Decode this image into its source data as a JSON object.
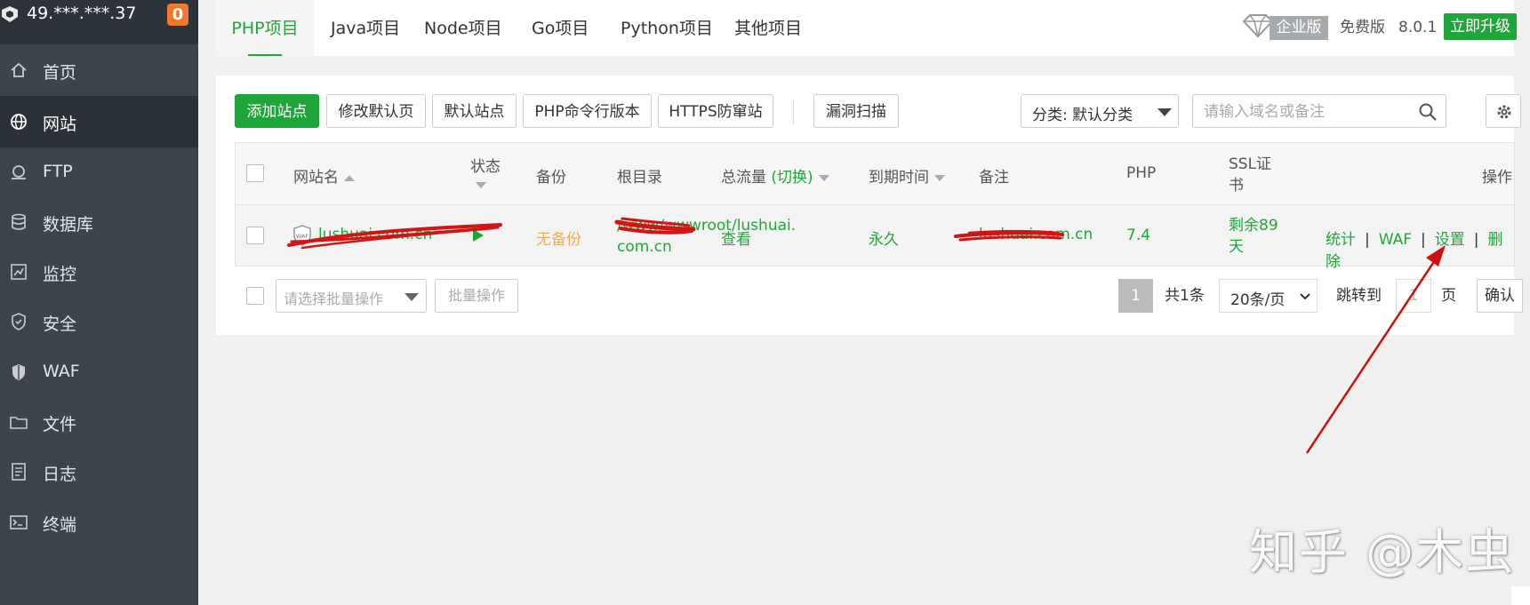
{
  "sidebar": {
    "server_ip": "49.***.***.37",
    "notification_count": "0",
    "items": [
      {
        "label": "首页",
        "icon": "home-icon",
        "active": false
      },
      {
        "label": "网站",
        "icon": "globe-icon",
        "active": true
      },
      {
        "label": "FTP",
        "icon": "ftp-icon",
        "active": false
      },
      {
        "label": "数据库",
        "icon": "database-icon",
        "active": false
      },
      {
        "label": "监控",
        "icon": "monitor-icon",
        "active": false
      },
      {
        "label": "安全",
        "icon": "shield-icon",
        "active": false
      },
      {
        "label": "WAF",
        "icon": "waf-shield-icon",
        "active": false
      },
      {
        "label": "文件",
        "icon": "folder-icon",
        "active": false
      },
      {
        "label": "日志",
        "icon": "log-icon",
        "active": false
      },
      {
        "label": "终端",
        "icon": "terminal-icon",
        "active": false
      }
    ]
  },
  "tabs": [
    {
      "label": "PHP项目",
      "active": true
    },
    {
      "label": "Java项目",
      "active": false
    },
    {
      "label": "Node项目",
      "active": false
    },
    {
      "label": "Go项目",
      "active": false
    },
    {
      "label": "Python项目",
      "active": false
    },
    {
      "label": "其他项目",
      "active": false
    }
  ],
  "header": {
    "enterprise_label": "企业版",
    "edition_label": "免费版",
    "version": "8.0.1",
    "upgrade_label": "立即升级"
  },
  "toolbar": {
    "add_site": "添加站点",
    "modify_default_page": "修改默认页",
    "default_site": "默认站点",
    "php_cli_version": "PHP命令行版本",
    "https_anti_snoop": "HTTPS防窜站",
    "vuln_scan": "漏洞扫描",
    "category_select": "分类: 默认分类",
    "search_placeholder": "请输入域名或备注"
  },
  "table": {
    "headers": {
      "site_name": "网站名",
      "status": "状态",
      "backup": "备份",
      "root_dir": "根目录",
      "traffic": "总流量",
      "traffic_switch": "(切换)",
      "expire": "到期时间",
      "remark": "备注",
      "php": "PHP",
      "ssl_line1": "SSL证",
      "ssl_line2": "书",
      "actions": "操作"
    },
    "rows": [
      {
        "site_name": "lushuai.com.cn",
        "waf_badge": "WAF",
        "backup": "无备份",
        "root_dir_line1": "/www/wwwroot/lushuai.",
        "root_dir_line2": "com.cn",
        "traffic": "查看",
        "expire": "永久",
        "remark": "lushuai.com.cn",
        "php": "7.4",
        "ssl_line1": "剩余89",
        "ssl_line2": "天",
        "actions": [
          "统计",
          "WAF",
          "设置",
          "删除"
        ]
      }
    ]
  },
  "footer": {
    "batch_placeholder": "请选择批量操作",
    "batch_button": "批量操作",
    "current_page": "1",
    "total_label": "共1条",
    "page_size": "20条/页",
    "jump_label": "跳转到",
    "jump_value": "1",
    "page_unit": "页",
    "confirm": "确认"
  },
  "watermark": "知乎 @木虫",
  "colors": {
    "accent": "#20a53a",
    "sidebar_bg": "#3c444d",
    "sidebar_active": "#2a3138",
    "badge": "#f0772e",
    "warning_text": "#f0ad4e",
    "annotation_red": "#cc1111"
  }
}
